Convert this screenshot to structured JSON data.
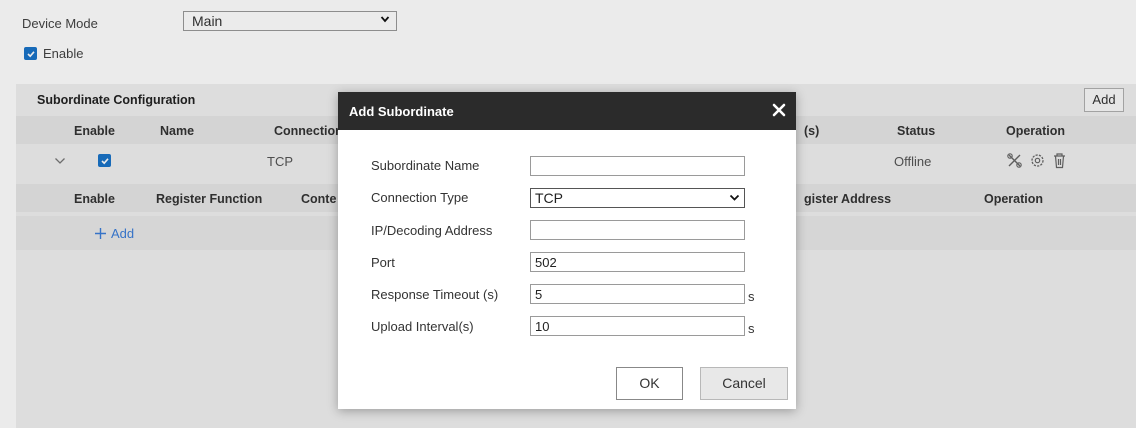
{
  "form": {
    "device_mode_label": "Device Mode",
    "device_mode_value": "Main",
    "enable_label": "Enable",
    "enable_checked": true
  },
  "panel": {
    "title": "Subordinate Configuration",
    "add_button": "Add",
    "columns": {
      "enable": "Enable",
      "name": "Name",
      "connection": "Connection",
      "interval_fragment": "(s)",
      "status": "Status",
      "operation": "Operation"
    },
    "row": {
      "connection": "TCP",
      "status": "Offline"
    },
    "sub_columns": {
      "enable": "Enable",
      "register_function": "Register Function",
      "content_fragment": "Conte",
      "register_address_fragment": "gister Address",
      "operation": "Operation"
    },
    "add_link": "Add"
  },
  "modal": {
    "title": "Add Subordinate",
    "fields": {
      "subordinate_name_label": "Subordinate Name",
      "subordinate_name_value": "",
      "connection_type_label": "Connection Type",
      "connection_type_value": "TCP",
      "ip_label": "IP/Decoding Address",
      "ip_value": "",
      "port_label": "Port",
      "port_value": "502",
      "response_timeout_label": "Response Timeout (s)",
      "response_timeout_value": "5",
      "upload_interval_label": "Upload Interval(s)",
      "upload_interval_value": "10",
      "unit": "s"
    },
    "ok_label": "OK",
    "cancel_label": "Cancel"
  },
  "colors": {
    "accent": "#1a73c8",
    "link": "#3b7dd8",
    "modal_header": "#2b2b2b"
  },
  "icons": [
    "chevron-down-icon",
    "checkbox-icon",
    "expand-chevron-icon",
    "tools-icon",
    "gear-icon",
    "trash-icon",
    "plus-icon",
    "close-icon"
  ]
}
